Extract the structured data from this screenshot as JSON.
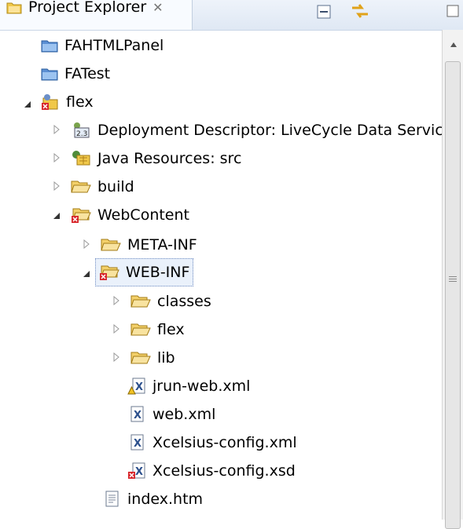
{
  "view": {
    "tab_title": "Project Explorer",
    "close_glyph": "✕",
    "toolbar": [
      "collapse-all-icon",
      "link-with-editor-icon",
      "view-menu-icon"
    ]
  },
  "tree": {
    "items": [
      {
        "label": "FAHTMLPanel",
        "icon": "folder-project-icon",
        "twisty": "none"
      },
      {
        "label": "FATest",
        "icon": "folder-project-icon",
        "twisty": "none"
      },
      {
        "label": "flex",
        "icon": "java-project-error-icon",
        "twisty": "expanded"
      },
      {
        "label": "Deployment Descriptor: LiveCycle Data Services",
        "icon": "deployment-descriptor-icon",
        "twisty": "collapsed"
      },
      {
        "label": "Java Resources: src",
        "icon": "java-resources-icon",
        "twisty": "collapsed"
      },
      {
        "label": "build",
        "icon": "folder-icon",
        "twisty": "collapsed"
      },
      {
        "label": "WebContent",
        "icon": "folder-error-icon",
        "twisty": "expanded"
      },
      {
        "label": "META-INF",
        "icon": "folder-icon",
        "twisty": "collapsed"
      },
      {
        "label": "WEB-INF",
        "icon": "folder-error-icon",
        "twisty": "expanded",
        "selected": true
      },
      {
        "label": "classes",
        "icon": "folder-icon",
        "twisty": "collapsed"
      },
      {
        "label": "flex",
        "icon": "folder-icon",
        "twisty": "collapsed"
      },
      {
        "label": "lib",
        "icon": "folder-icon",
        "twisty": "collapsed"
      },
      {
        "label": "jrun-web.xml",
        "icon": "xml-file-warning-icon",
        "twisty": "none"
      },
      {
        "label": "web.xml",
        "icon": "xml-file-icon",
        "twisty": "none"
      },
      {
        "label": "Xcelsius-config.xml",
        "icon": "xml-file-icon",
        "twisty": "none"
      },
      {
        "label": "Xcelsius-config.xsd",
        "icon": "xsd-file-error-icon",
        "twisty": "none"
      },
      {
        "label": "index.htm",
        "icon": "text-file-icon",
        "twisty": "none"
      }
    ]
  }
}
